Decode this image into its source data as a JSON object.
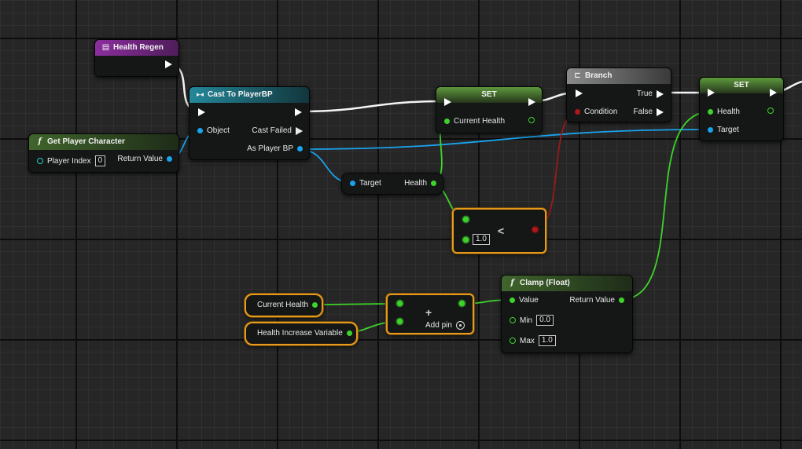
{
  "event_node": {
    "title": "Health Regen"
  },
  "get_player_node": {
    "title": "Get Player Character",
    "player_index_label": "Player Index",
    "player_index_value": "0",
    "return_label": "Return Value"
  },
  "cast_node": {
    "title": "Cast To PlayerBP",
    "object_label": "Object",
    "cast_failed_label": "Cast Failed",
    "as_player_label": "As Player BP"
  },
  "get_health_node": {
    "target_label": "Target",
    "health_label": "Health"
  },
  "set1_node": {
    "title": "SET",
    "current_health_label": "Current Health"
  },
  "branch_node": {
    "title": "Branch",
    "true_label": "True",
    "false_label": "False",
    "condition_label": "Condition"
  },
  "set2_node": {
    "title": "SET",
    "health_label": "Health",
    "target_label": "Target"
  },
  "less_node": {
    "operator": "<",
    "value": "1.0"
  },
  "current_health_var": {
    "label": "Current Health"
  },
  "health_increase_var": {
    "label": "Health Increase Variable"
  },
  "add_node": {
    "operator": "+",
    "add_pin_label": "Add pin"
  },
  "clamp_node": {
    "title": "Clamp (Float)",
    "value_label": "Value",
    "return_label": "Return Value",
    "min_label": "Min",
    "min_value": "0.0",
    "max_label": "Max",
    "max_value": "1.0"
  },
  "colors": {
    "event_header": "#7d2d8f",
    "function_header": "#395e2a",
    "cast_header": "#1f7481",
    "exec": "#ffffff",
    "float_pin": "#3ed32b",
    "object_pin": "#1aa3ee",
    "bool_pin": "#b01717",
    "selection": "#e89b1b"
  }
}
